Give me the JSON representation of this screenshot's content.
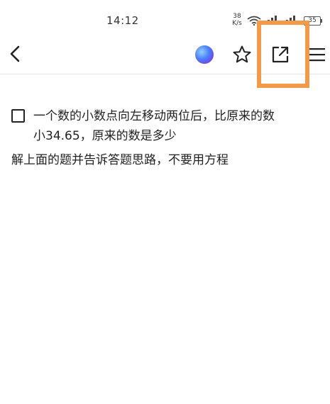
{
  "status_bar": {
    "time": "14:12",
    "net_speed_value": "38",
    "net_speed_unit": "K/s",
    "battery": "35",
    "wifi_icon": "wifi-icon",
    "signal_icon": "signal-icon"
  },
  "toolbar": {
    "back_icon": "chevron-left-icon",
    "ai_icon": "ai-assistant-icon",
    "star_icon": "star-icon",
    "share_icon": "open-external-icon",
    "menu_icon": "menu-icon",
    "highlight_color": "#f39a4a"
  },
  "content": {
    "question_line1": "一个数的小数点向左移动两位后，比原来的数",
    "question_line2": "小34.65，原来的数是多少",
    "instruction": "解上面的题并告诉答题思路，不要用方程"
  }
}
